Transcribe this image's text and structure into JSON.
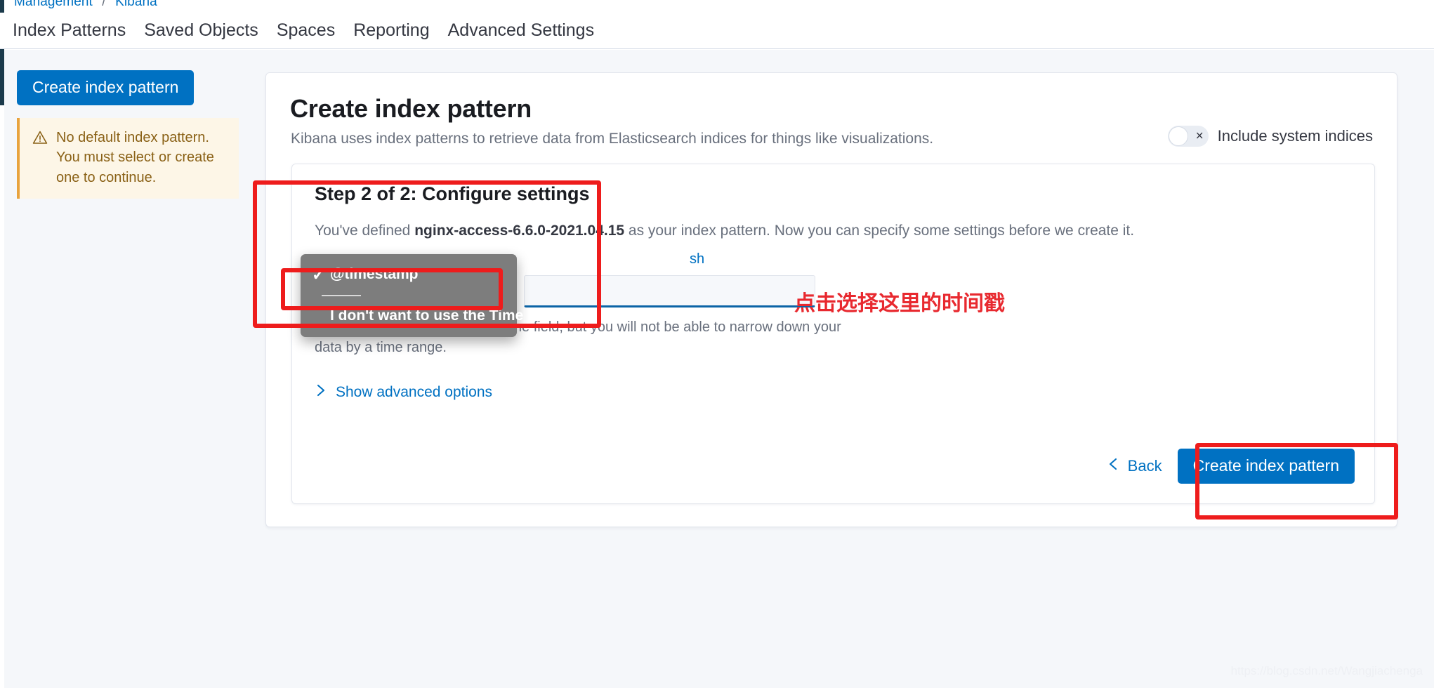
{
  "breadcrumb": {
    "root": "Management",
    "separator": "/",
    "current": "Kibana"
  },
  "nav": {
    "tabs": [
      {
        "label": "Index Patterns"
      },
      {
        "label": "Saved Objects"
      },
      {
        "label": "Spaces"
      },
      {
        "label": "Reporting"
      },
      {
        "label": "Advanced Settings"
      }
    ]
  },
  "sidebar": {
    "create_button": "Create index pattern",
    "warning": {
      "icon": "warning-triangle-icon",
      "text": "No default index pattern. You must select or create one to continue."
    }
  },
  "panel": {
    "title": "Create index pattern",
    "subtitle": "Kibana uses index patterns to retrieve data from Elasticsearch indices for things like visualizations.",
    "system_indices": {
      "label": "Include system indices",
      "state": "off",
      "off_glyph": "×"
    }
  },
  "step": {
    "title": "Step 2 of 2: Configure settings",
    "description_prefix": "You've defined ",
    "index_pattern": "nginx-access-6.6.0-2021.04.15",
    "description_suffix": " as your index pattern. Now you can specify some settings before we create it.",
    "refresh_link_visible_fragment": "sh",
    "help_text": "You can choose not to have a time field, but you will not be able to narrow down your data by a time range.",
    "advanced_options_label": "Show advanced options",
    "advanced_options_icon": "chevron-right-icon"
  },
  "dropdown": {
    "options": [
      {
        "label": "@timestamp",
        "selected": true,
        "check_glyph": "✓"
      },
      {
        "label": "I don't want to use the Time Filter",
        "selected": false,
        "check_glyph": ""
      }
    ]
  },
  "footer": {
    "back_label": "Back",
    "back_icon": "chevron-left-icon",
    "create_label": "Create index pattern"
  },
  "annotations": {
    "note_text": "点击选择这里的时间戳",
    "color": "#ee1c1c"
  },
  "watermark": {
    "text": "https://blog.csdn.net/Wangjiachenga"
  },
  "colors": {
    "primary_blue": "#0071c2",
    "annotation_red": "#ee1c1c",
    "warning_amber": "#e8a33d",
    "dropdown_gray": "#7d7d7d"
  }
}
